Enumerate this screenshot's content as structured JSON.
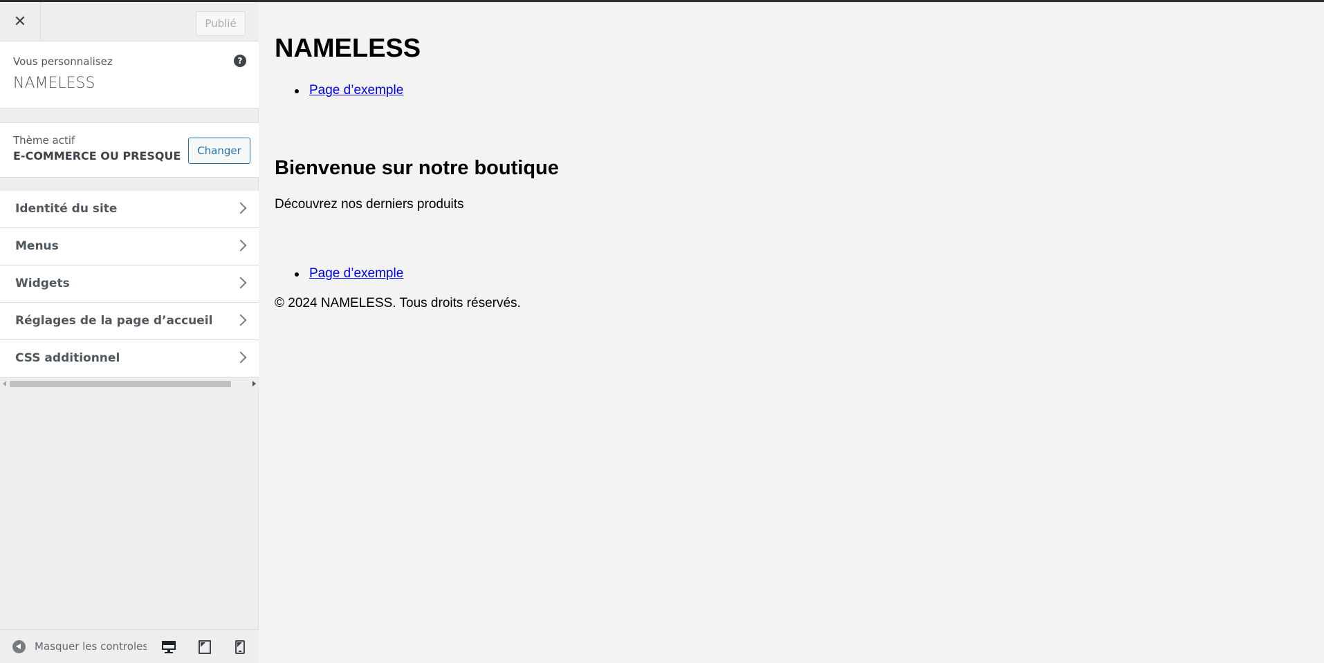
{
  "sidebar": {
    "close_symbol": "✕",
    "publish_label": "Publié",
    "customizing_label": "Vous personnalisez",
    "site_name": "NAMELESS",
    "help_symbol": "?",
    "theme_label": "Thème actif",
    "theme_name": "E-COMMERCE OU PRESQUE",
    "change_label": "Changer",
    "sections": [
      {
        "label": "Identité du site"
      },
      {
        "label": "Menus"
      },
      {
        "label": "Widgets"
      },
      {
        "label": "Réglages de la page d’accueil"
      },
      {
        "label": "CSS additionnel"
      }
    ],
    "collapse_label": "Masquer les controles",
    "devices": [
      "desktop-icon",
      "tablet-icon",
      "mobile-icon"
    ],
    "accent_color": "#2271b1"
  },
  "preview": {
    "site_title": "NAMELESS",
    "top_menu": [
      "Page d’exemple"
    ],
    "welcome_heading": "Bienvenue sur notre boutique",
    "tagline": "Découvrez nos derniers produits",
    "footer_menu": [
      "Page d’exemple"
    ],
    "copyright": "© 2024 NAMELESS. Tous droits réservés.",
    "link_color": "#0000ee"
  }
}
